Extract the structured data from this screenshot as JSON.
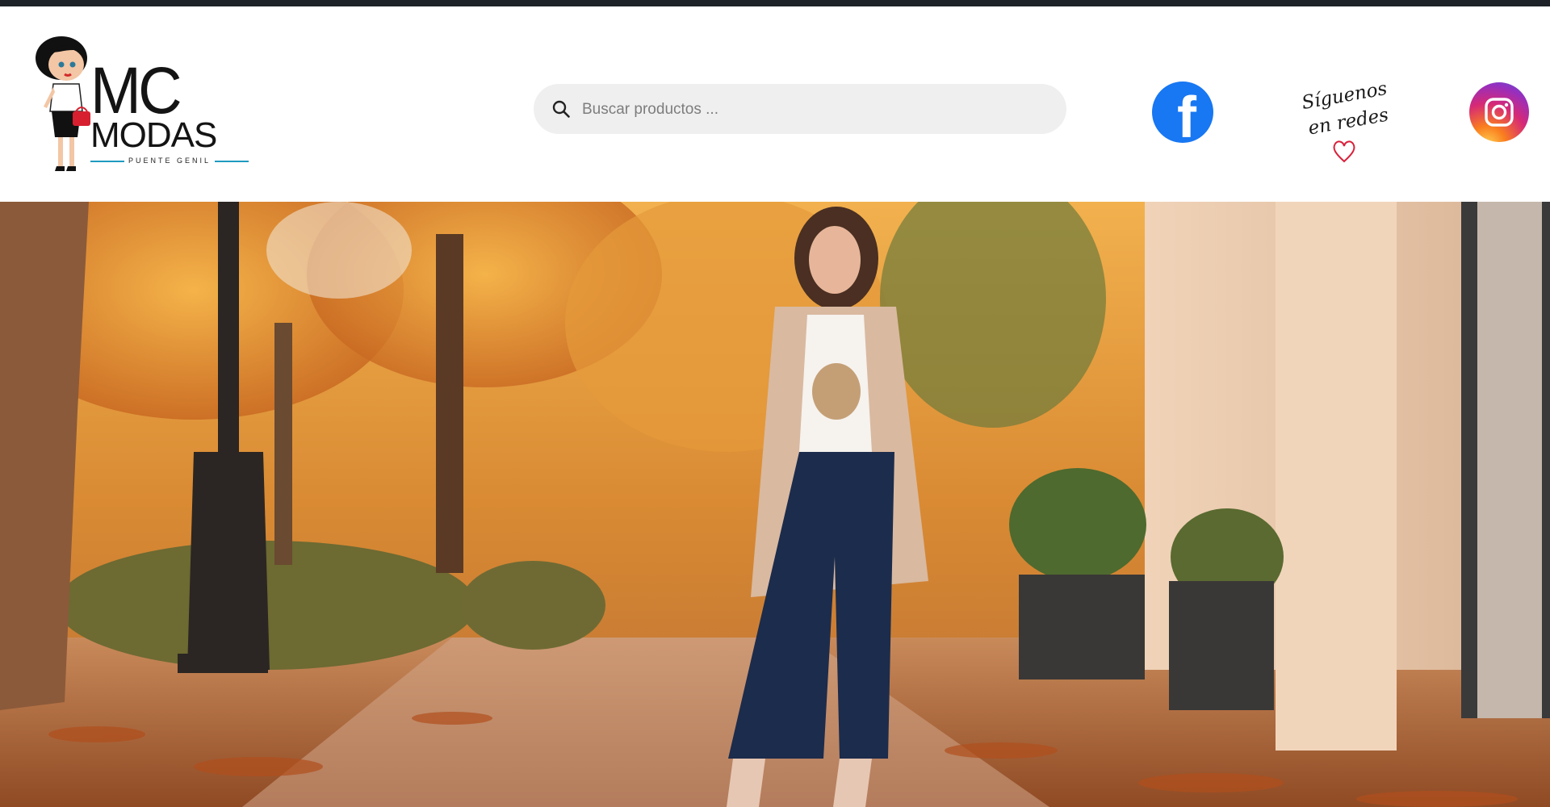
{
  "brand": {
    "name_line1": "MC",
    "name_line2": "MODAS",
    "location": "PUENTE GENIL"
  },
  "search": {
    "placeholder": "Buscar productos ..."
  },
  "social": {
    "facebook_glyph": "f",
    "follow_line1": "Síguenos",
    "follow_line2": "en redes",
    "icons": [
      "facebook-icon",
      "instagram-icon",
      "heart-icon"
    ]
  },
  "colors": {
    "topbar": "#1c2228",
    "search_bg": "#efefef",
    "facebook": "#1877f2",
    "accent_line": "#1f9bbf"
  },
  "hero": {
    "alt": "hero-banner"
  }
}
